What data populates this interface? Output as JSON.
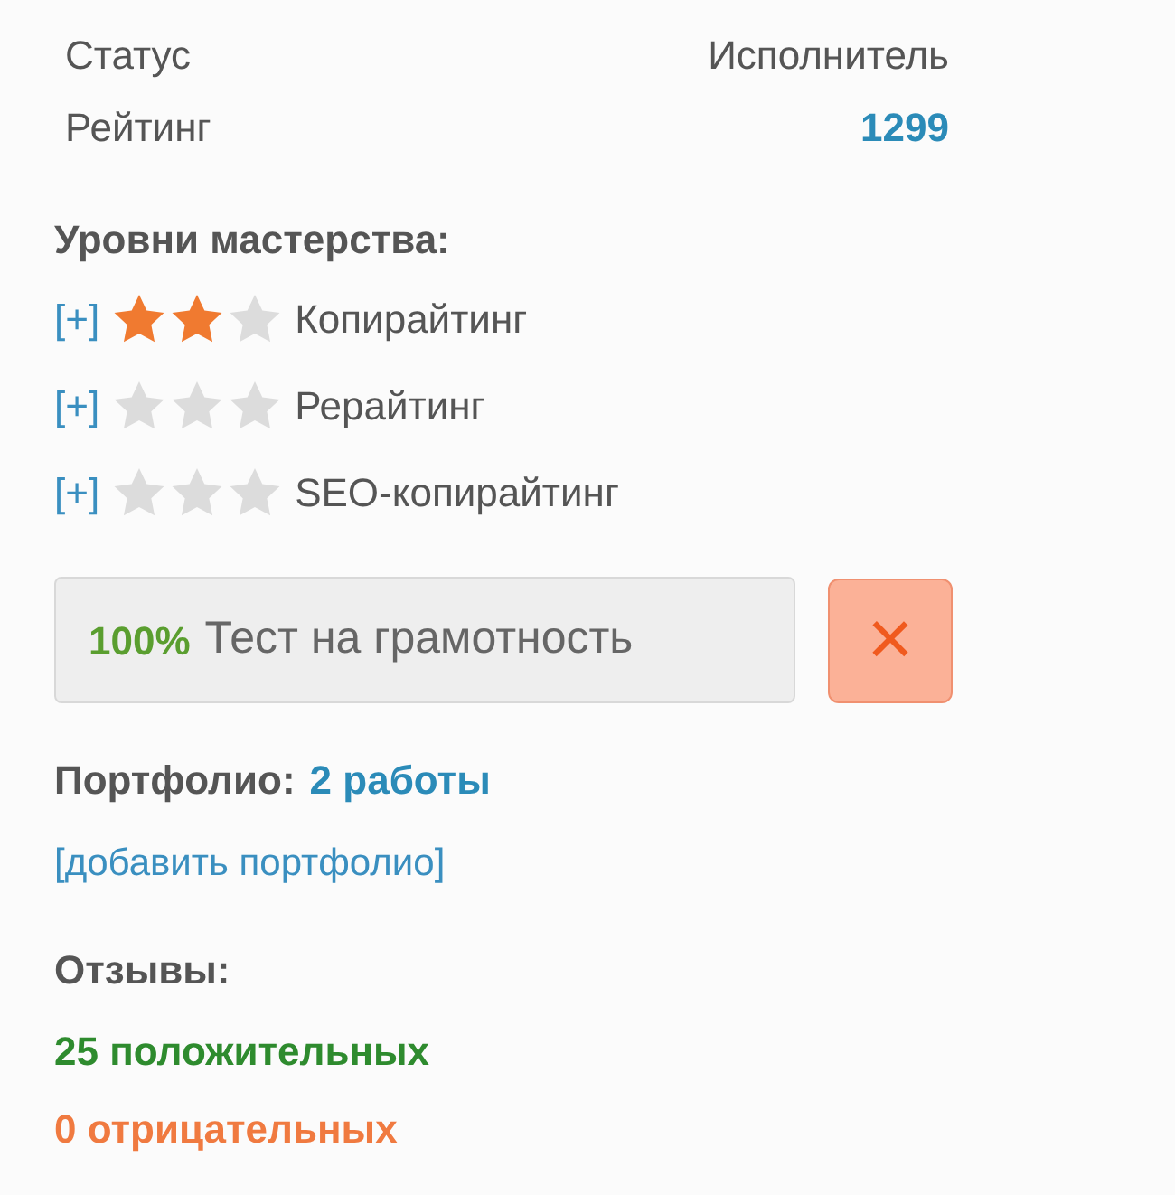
{
  "info": [
    {
      "label": "Статус",
      "value": "Исполнитель",
      "kind": "plain"
    },
    {
      "label": "Рейтинг",
      "value": "1299",
      "kind": "rating"
    }
  ],
  "skills_title": "Уровни мастерства:",
  "skills": [
    {
      "toggle": "[+]",
      "stars": 2,
      "name": "Копирайтинг"
    },
    {
      "toggle": "[+]",
      "stars": 0,
      "name": "Рерайтинг"
    },
    {
      "toggle": "[+]",
      "stars": 0,
      "name": "SEO-копирайтинг"
    }
  ],
  "test": {
    "score": "100%",
    "label": "Тест на грамотность",
    "close": "×"
  },
  "portfolio": {
    "label": "Портфолио:",
    "count": "2 работы",
    "add_link": "[добавить портфолио]"
  },
  "reviews": {
    "title": "Отзывы:",
    "positive": "25 положительных",
    "negative": "0 отрицательных"
  }
}
